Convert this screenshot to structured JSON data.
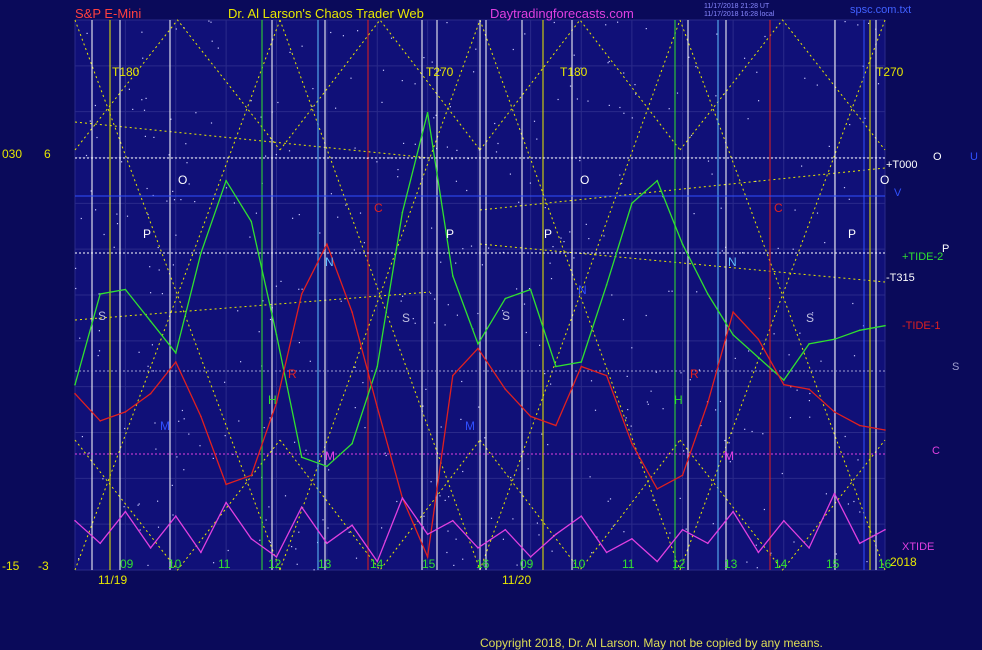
{
  "header": {
    "symbol": "S&P E-Mini",
    "title": "Dr. Al Larson's Chaos Trader Web",
    "site": "Daytradingforecasts.com",
    "stamp_line1": "11/17/2018 21:28 UT",
    "stamp_line2": "11/17/2018 16:28 local",
    "filename": "spsc.com.txt"
  },
  "colors": {
    "background": "#0a0a5a",
    "plot_bg": "#101078",
    "grid": "#2a2a8a",
    "yellow": "#e8e800",
    "green": "#30e030",
    "red": "#e02020",
    "white": "#ffffff",
    "magenta": "#e040e0",
    "cyan": "#60c0ff",
    "blue_line": "#3050ff"
  },
  "left_labels": {
    "top_a": "030",
    "top_b": "6",
    "bottom_a": "-15",
    "bottom_b": "-3"
  },
  "right_labels": {
    "o1": "O",
    "u1": "U",
    "v1": "V",
    "p1": "P",
    "s1": "S",
    "c1": "C",
    "year": "2018"
  },
  "dates": [
    "11/19",
    "11/20"
  ],
  "hour_labels": [
    "09",
    "10",
    "11",
    "12",
    "13",
    "14",
    "15",
    "16",
    "09",
    "10",
    "11",
    "12",
    "13",
    "14",
    "15",
    "16"
  ],
  "top_markers": [
    "T180",
    "T270",
    "T180",
    "T270"
  ],
  "line_labels": {
    "t000": "+T000",
    "tide2": "+TIDE-2",
    "t315": "-T315",
    "tide1": "-TIDE-1",
    "xtide": "XTIDE"
  },
  "letter_markers": {
    "o": "O",
    "p": "P",
    "s": "S",
    "n": "N",
    "h": "H",
    "m": "M",
    "c": "C",
    "r": "R"
  },
  "copyright": "Copyright 2018, Dr. Al Larson. May not be copied by any means.",
  "chart_data": {
    "type": "line",
    "title": "S&P E-Mini",
    "x_labels": [
      "09",
      "10",
      "11",
      "12",
      "13",
      "14",
      "15",
      "16",
      "09",
      "10",
      "11",
      "12",
      "13",
      "14",
      "15",
      "16"
    ],
    "dates": [
      "11/19",
      "11/20"
    ],
    "y_left_range_outer": [
      -15,
      30
    ],
    "y_left_range_inner": [
      -3,
      6
    ],
    "series": [
      {
        "name": "+TIDE-2",
        "color": "#30e030",
        "x": [
          0.0,
          0.5,
          1.0,
          1.5,
          2.0,
          2.5,
          3.0,
          3.5,
          4.0,
          4.5,
          5.0,
          5.5,
          6.0,
          6.5,
          7.0,
          7.5,
          8.0,
          8.5,
          9.0,
          9.5,
          10.0,
          10.5,
          11.0,
          11.5,
          12.0,
          12.5,
          13.0,
          13.5,
          14.0,
          14.5,
          15.0,
          15.5,
          16.0
        ],
        "y": [
          1.0,
          3.0,
          3.1,
          2.4,
          1.7,
          3.9,
          5.5,
          4.6,
          2.1,
          -0.6,
          -0.8,
          -0.3,
          1.4,
          4.8,
          7.0,
          3.4,
          1.9,
          2.9,
          3.1,
          1.4,
          1.5,
          3.2,
          5.0,
          5.5,
          4.1,
          3.0,
          2.1,
          1.6,
          1.1,
          1.9,
          2.0,
          2.2,
          2.3
        ]
      },
      {
        "name": "-TIDE-1",
        "color": "#e02020",
        "x": [
          0.0,
          0.5,
          1.0,
          1.5,
          2.0,
          2.5,
          3.0,
          3.5,
          4.0,
          4.5,
          5.0,
          5.5,
          6.0,
          6.5,
          7.0,
          7.5,
          8.0,
          8.5,
          9.0,
          9.5,
          10.0,
          10.5,
          11.0,
          11.5,
          12.0,
          12.5,
          13.0,
          13.5,
          14.0,
          14.5,
          15.0,
          15.5,
          16.0
        ],
        "y": [
          0.8,
          0.2,
          0.4,
          0.8,
          1.5,
          0.3,
          -1.2,
          -1.0,
          0.6,
          3.0,
          4.1,
          2.6,
          0.5,
          -1.5,
          -2.8,
          1.2,
          1.8,
          0.9,
          0.3,
          0.1,
          1.4,
          1.2,
          -0.3,
          -1.3,
          -1.0,
          0.6,
          2.6,
          2.0,
          1.0,
          0.9,
          0.4,
          0.1,
          0.0
        ]
      },
      {
        "name": "XTIDE",
        "color": "#e040e0",
        "x": [
          0.0,
          0.5,
          1.0,
          1.5,
          2.0,
          2.5,
          3.0,
          3.5,
          4.0,
          4.5,
          5.0,
          5.5,
          6.0,
          6.5,
          7.0,
          7.5,
          8.0,
          8.5,
          9.0,
          9.5,
          10.0,
          10.5,
          11.0,
          11.5,
          12.0,
          12.5,
          13.0,
          13.5,
          14.0,
          14.5,
          15.0,
          15.5,
          16.0
        ],
        "y": [
          -2.0,
          -2.5,
          -1.8,
          -2.6,
          -1.9,
          -2.7,
          -1.6,
          -2.4,
          -2.8,
          -1.7,
          -2.5,
          -2.1,
          -2.9,
          -1.5,
          -2.3,
          -2.0,
          -2.6,
          -2.2,
          -2.8,
          -2.3,
          -1.9,
          -2.7,
          -2.4,
          -2.9,
          -2.2,
          -2.5,
          -1.8,
          -2.7,
          -2.0,
          -2.6,
          -1.4,
          -2.5,
          -2.2
        ]
      }
    ]
  }
}
